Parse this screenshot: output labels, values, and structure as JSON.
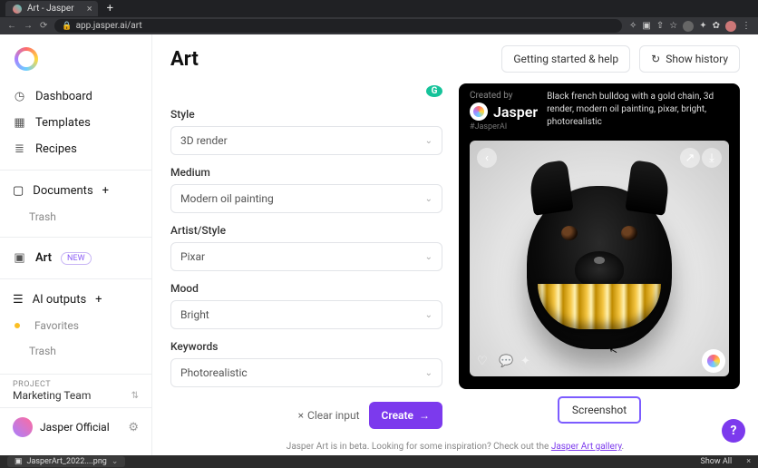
{
  "browser": {
    "tab_title": "Art - Jasper",
    "url": "app.jasper.ai/art",
    "download_file": "JasperArt_2022....png",
    "download_showall": "Show All"
  },
  "sidebar": {
    "items": [
      {
        "label": "Dashboard"
      },
      {
        "label": "Templates"
      },
      {
        "label": "Recipes"
      },
      {
        "label": "Documents"
      },
      {
        "label": "Trash"
      },
      {
        "label": "Art"
      },
      {
        "label": "AI outputs"
      },
      {
        "label": "Favorites"
      },
      {
        "label": "Trash"
      }
    ],
    "new_badge": "NEW",
    "project_label": "PROJECT",
    "project_value": "Marketing Team",
    "user_name": "Jasper Official"
  },
  "header": {
    "title": "Art",
    "getting_started": "Getting started & help",
    "show_history": "Show history"
  },
  "form": {
    "style_label": "Style",
    "style_value": "3D render",
    "medium_label": "Medium",
    "medium_value": "Modern oil painting",
    "artist_label": "Artist/Style",
    "artist_value": "Pixar",
    "mood_label": "Mood",
    "mood_value": "Bright",
    "keywords_label": "Keywords",
    "keywords_value": "Photorealistic",
    "clear": "Clear input",
    "create": "Create"
  },
  "preview": {
    "created_by": "Created by",
    "brand": "Jasper",
    "handle": "#JasperAI",
    "description": "Black french bulldog with a gold chain, 3d render, modern oil painting, pixar, bright, photorealistic",
    "screenshot": "Screenshot"
  },
  "footer": {
    "text_a": "Jasper Art is in beta. Looking for some inspiration? Check out the ",
    "link": "Jasper Art gallery",
    "text_b": "."
  }
}
